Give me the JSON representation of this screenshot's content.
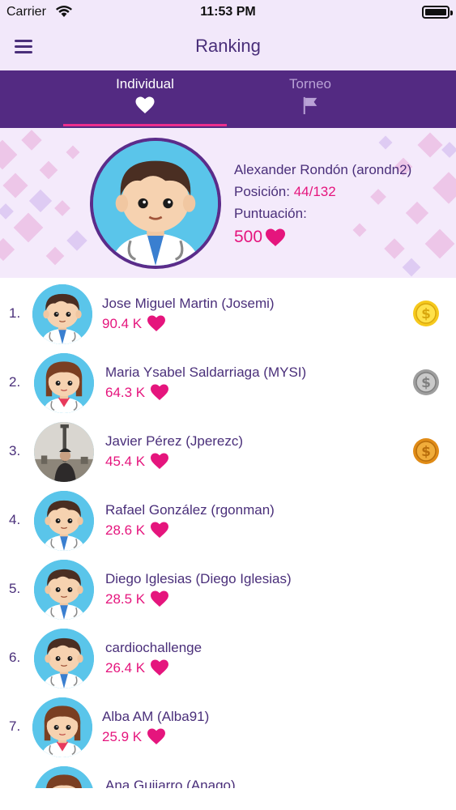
{
  "status_bar": {
    "carrier": "Carrier",
    "time": "11:53 PM"
  },
  "nav": {
    "title": "Ranking",
    "menu_icon": "hamburger-menu-icon"
  },
  "tabs": [
    {
      "label": "Individual",
      "icon": "heart-icon",
      "selected": true
    },
    {
      "label": "Torneo",
      "icon": "flag-icon",
      "selected": false
    }
  ],
  "profile": {
    "name": "Alexander Rondón (arondn2)",
    "position_label": "Posición:",
    "position_value": "44/132",
    "score_label": "Puntuación:",
    "score_value": "500"
  },
  "ranking": [
    {
      "rank": "1.",
      "name": "Jose Miguel Martin (Josemi)",
      "points": "90.4 K",
      "avatar": "doctor-boy",
      "medal": "gold"
    },
    {
      "rank": "2.",
      "name": "Maria Ysabel Saldarriaga (MYSI)",
      "points": "64.3 K",
      "avatar": "doctor-girl",
      "medal": "silver"
    },
    {
      "rank": "3.",
      "name": "Javier Pérez (Jperezc)",
      "points": "45.4 K",
      "avatar": "photo",
      "medal": "bronze"
    },
    {
      "rank": "4.",
      "name": "Rafael González (rgonman)",
      "points": "28.6 K",
      "avatar": "doctor-boy",
      "medal": ""
    },
    {
      "rank": "5.",
      "name": "Diego Iglesias (Diego Iglesias)",
      "points": "28.5 K",
      "avatar": "doctor-boy",
      "medal": ""
    },
    {
      "rank": "6.",
      "name": "cardiochallenge",
      "points": "26.4 K",
      "avatar": "doctor-boy",
      "medal": ""
    },
    {
      "rank": "7.",
      "name": "Alba AM (Alba91)",
      "points": "25.9 K",
      "avatar": "doctor-girl",
      "medal": ""
    },
    {
      "rank": "",
      "name": "Ana Guijarro (Anago)",
      "points": "",
      "avatar": "doctor-girl",
      "medal": ""
    }
  ],
  "colors": {
    "accent_pink": "#e5157d",
    "tab_bar": "#532a82",
    "text_purple": "#4a2f7a",
    "gold": "#f6c91c",
    "silver": "#a9a9a9",
    "bronze": "#e49a25"
  }
}
